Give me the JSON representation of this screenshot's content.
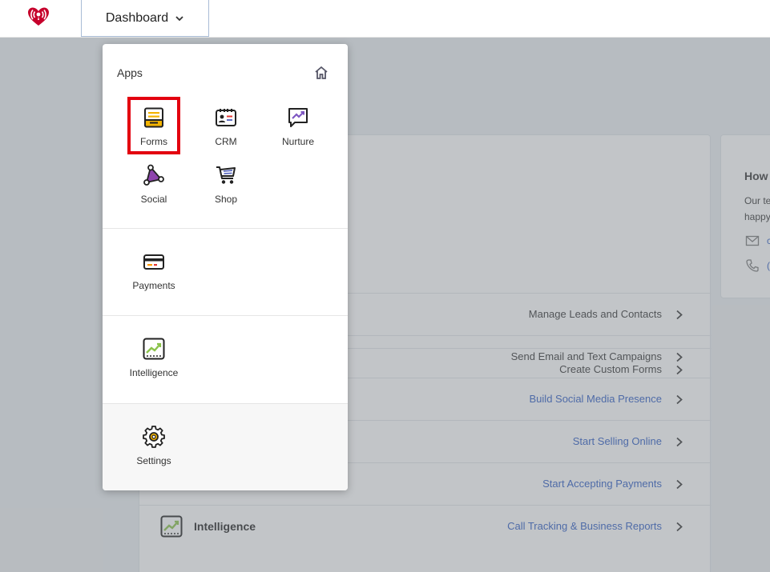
{
  "topbar": {
    "dashboard_label": "Dashboard"
  },
  "panel": {
    "apps_title": "Apps",
    "apps": [
      {
        "label": "Forms",
        "icon": "forms-icon"
      },
      {
        "label": "CRM",
        "icon": "crm-icon"
      },
      {
        "label": "Nurture",
        "icon": "nurture-icon"
      },
      {
        "label": "Social",
        "icon": "social-icon"
      },
      {
        "label": "Shop",
        "icon": "shop-icon"
      }
    ],
    "payments_label": "Payments",
    "intelligence_label": "Intelligence",
    "settings_label": "Settings"
  },
  "main": {
    "rows": [
      {
        "text": "Create Custom Forms"
      },
      {
        "text": "Manage Leads and Contacts"
      },
      {
        "text": "Send Email and Text Campaigns"
      },
      {
        "text": "Build Social Media Presence"
      },
      {
        "text": "Start Selling Online"
      },
      {
        "text": "Start Accepting Payments"
      },
      {
        "text": "Call Tracking & Business Reports",
        "title": "Intelligence"
      }
    ]
  },
  "side": {
    "title": "How",
    "line1": "Our te",
    "line2": "happy",
    "email_text": "c",
    "phone_text": "("
  },
  "colors": {
    "brand": "#c6002b",
    "highlight": "#e3000f",
    "link": "#2d5bc4"
  }
}
